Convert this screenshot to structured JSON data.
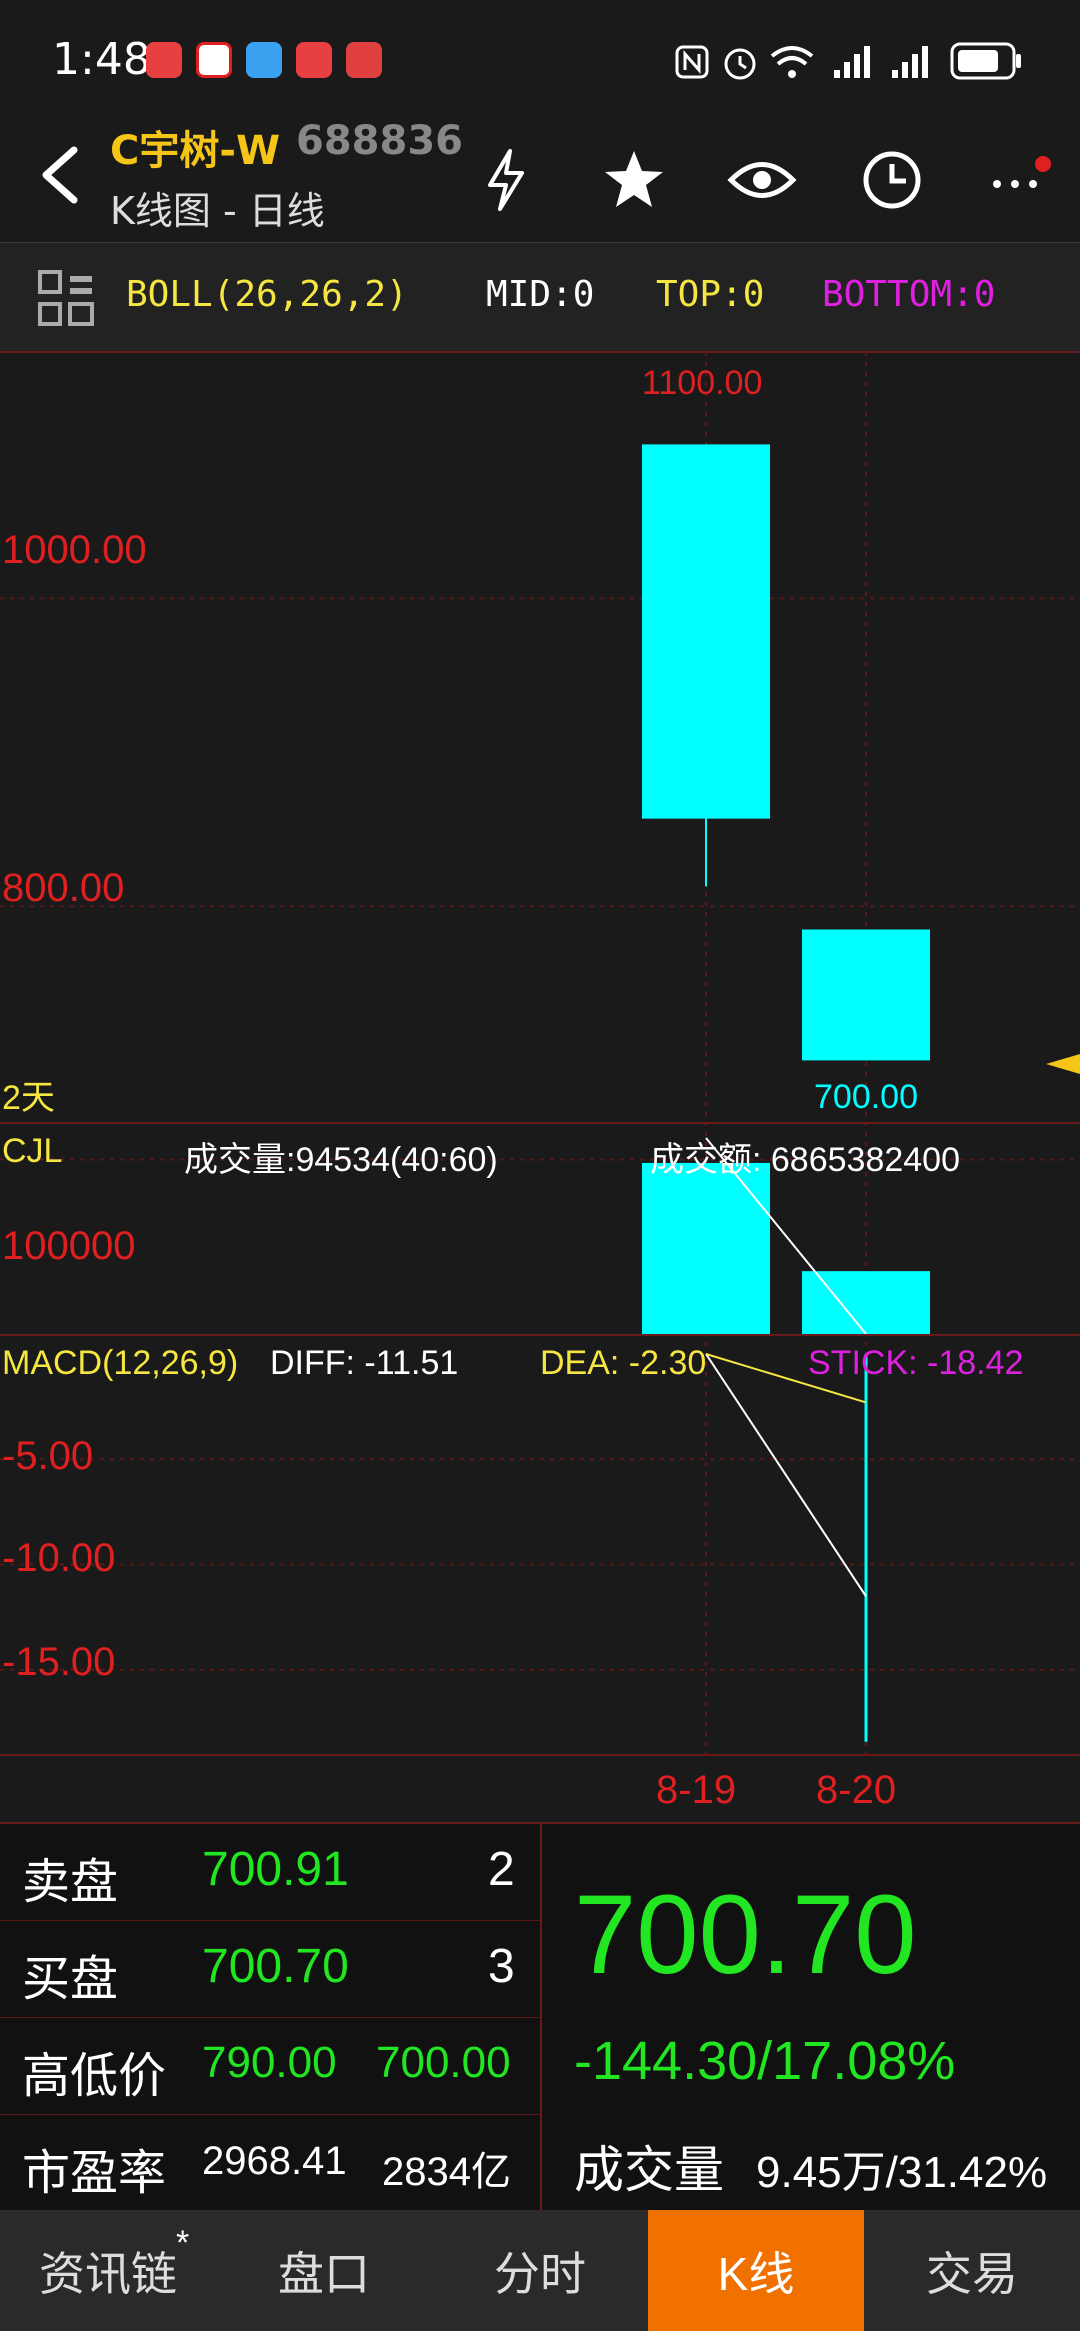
{
  "status_bar": {
    "time": "1:48",
    "app_icons": [
      {
        "name": "app-icon-1",
        "color": "#e84040",
        "text": "天府"
      },
      {
        "name": "app-icon-2",
        "color": "#e02020",
        "text": "招"
      },
      {
        "name": "app-icon-3",
        "color": "#3aa0f0",
        "text": "●"
      },
      {
        "name": "app-icon-4",
        "color": "#e84040",
        "text": "头条"
      },
      {
        "name": "app-icon-5",
        "color": "#e04040",
        "text": "☺"
      }
    ],
    "system_icons": [
      "nfc-icon",
      "alarm-icon",
      "wifi-icon",
      "signal-icon",
      "signal-icon",
      "battery-icon"
    ]
  },
  "header": {
    "stock_name": "C宇树-W",
    "stock_code": "688836",
    "subtitle": "K线图 - 日线",
    "icons": [
      "flash-icon",
      "star-icon",
      "eye-icon",
      "clock-icon",
      "more-icon"
    ]
  },
  "indicator_bar": {
    "boll": "BOLL(26,26,2)",
    "mid": "MID:0",
    "top": "TOP:0",
    "bottom": "BOTTOM:0"
  },
  "kline": {
    "y_labels": [
      "1000.00",
      "800.00"
    ],
    "top_price": "1100.00",
    "bottom_price": "700.00",
    "period_label": "2天"
  },
  "volume": {
    "title": "CJL",
    "vol_text": "成交量:94534(40:60)",
    "amount_text": "成交额: 6865382400",
    "y_label": "100000"
  },
  "macd": {
    "title": "MACD(12,26,9)",
    "diff": "DIFF: -11.51",
    "dea": "DEA: -2.30",
    "stick": "STICK: -18.42",
    "y_labels": [
      "-5.00",
      "-10.00",
      "-15.00"
    ]
  },
  "dates": [
    "8-19",
    "8-20"
  ],
  "chart_data": {
    "type": "candlestick",
    "categories": [
      "8-19",
      "8-20"
    ],
    "candles": [
      {
        "date": "8-19",
        "open": 1100,
        "close": 857,
        "high": 1100,
        "low": 813
      },
      {
        "date": "8-20",
        "open": 785,
        "close": 700,
        "high": 785,
        "low": 700
      }
    ],
    "price_range": [
      660,
      1160
    ],
    "volume": [
      98000,
      36000
    ],
    "volume_range": [
      0,
      110000
    ],
    "macd_diff": [
      0,
      -11.51
    ],
    "macd_dea": [
      0,
      -2.3
    ],
    "macd_stick": [
      0,
      -18.42
    ],
    "macd_range": [
      -19,
      0
    ]
  },
  "quotes": {
    "sell_label": "卖盘",
    "sell_price": "700.91",
    "sell_qty": "2",
    "buy_label": "买盘",
    "buy_price": "700.70",
    "buy_qty": "3",
    "hl_label": "高低价",
    "high": "790.00",
    "low": "700.00",
    "pe_label": "市盈率",
    "pe": "2968.41",
    "mcap": "2834亿",
    "last_price": "700.70",
    "change": "-144.30/17.08%",
    "vol_label": "成交量",
    "vol_value": "9.45万/31.42%"
  },
  "tabs": [
    {
      "label": "资讯链",
      "name": "tab-news"
    },
    {
      "label": "盘口",
      "name": "tab-orderbook"
    },
    {
      "label": "分时",
      "name": "tab-intraday"
    },
    {
      "label": "K线",
      "name": "tab-kline"
    },
    {
      "label": "交易",
      "name": "tab-trade"
    }
  ],
  "colors": {
    "accent": "#f07000",
    "up": "#e02020",
    "down": "#00ffff",
    "green": "#22e622",
    "yellow": "#f5e642",
    "magenta": "#e020e0"
  }
}
